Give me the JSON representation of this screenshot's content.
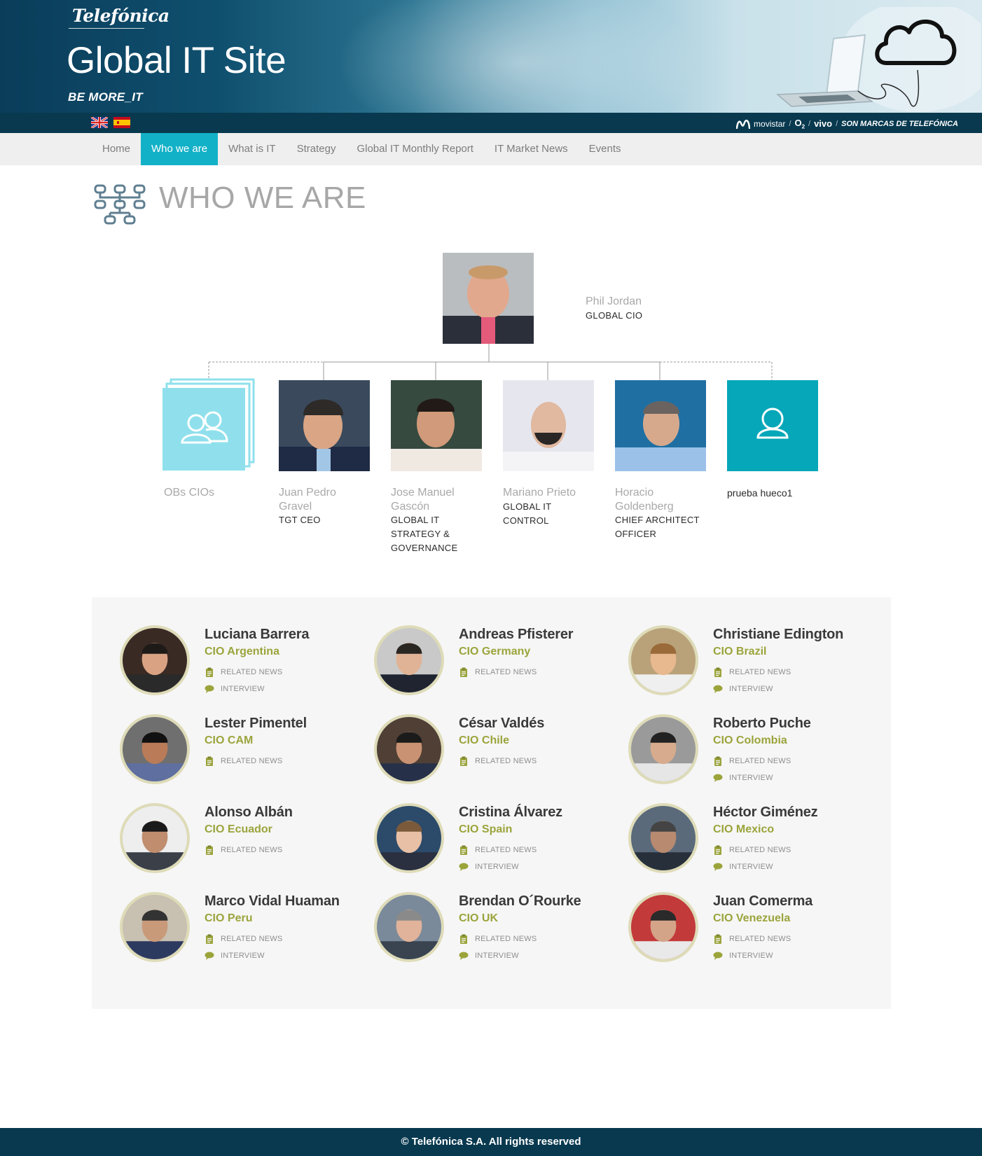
{
  "header": {
    "brand": "Telefónica",
    "site_title": "Global IT Site",
    "tagline": "BE MORE_IT",
    "brands": {
      "movistar": "movistar",
      "o2": "O",
      "o2_sub": "2",
      "vivo": "vivo",
      "owner": "SON MARCAS DE TELEFÓNICA"
    },
    "languages": [
      "English",
      "Español"
    ]
  },
  "nav": {
    "items": [
      {
        "label": "Home"
      },
      {
        "label": "Who we are"
      },
      {
        "label": "What is IT"
      },
      {
        "label": "Strategy"
      },
      {
        "label": "Global IT Monthly Report"
      },
      {
        "label": "IT Market News"
      },
      {
        "label": "Events"
      }
    ],
    "active": "Who we are"
  },
  "page": {
    "title": "WHO WE ARE"
  },
  "org": {
    "head": {
      "name": "Phil Jordan",
      "role": "GLOBAL CIO"
    },
    "reports": [
      {
        "name": "OBs CIOs",
        "role": ""
      },
      {
        "name_l1": "Juan Pedro",
        "name_l2": "Gravel",
        "role_l1": "TGT CEO"
      },
      {
        "name_l1": "Jose Manuel",
        "name_l2": "Gascón",
        "role_l1": "GLOBAL IT",
        "role_l2": "STRATEGY &",
        "role_l3": "GOVERNANCE"
      },
      {
        "name_l1": "Mariano Prieto",
        "role_l1": "GLOBAL IT",
        "role_l2": "CONTROL"
      },
      {
        "name_l1": "Horacio",
        "name_l2": "Goldenberg",
        "role_l1": "CHIEF ARCHITECT",
        "role_l2": "OFFICER"
      },
      {
        "name_l1": "prueba hueco1"
      }
    ]
  },
  "cio_links": {
    "news": "RELATED NEWS",
    "interview": "INTERVIEW"
  },
  "cios": [
    {
      "name": "Luciana Barrera",
      "title": "CIO Argentina",
      "interview": true
    },
    {
      "name": "Andreas Pfisterer",
      "title": "CIO Germany",
      "interview": false
    },
    {
      "name": "Christiane Edington",
      "title": "CIO Brazil",
      "interview": true
    },
    {
      "name": "Lester Pimentel",
      "title": "CIO CAM",
      "interview": false
    },
    {
      "name": "César Valdés",
      "title": "CIO Chile",
      "interview": false
    },
    {
      "name": "Roberto Puche",
      "title": "CIO Colombia",
      "interview": true
    },
    {
      "name": "Alonso Albán",
      "title": "CIO Ecuador",
      "interview": false
    },
    {
      "name": "Cristina Álvarez",
      "title": "CIO Spain",
      "interview": true
    },
    {
      "name": "Héctor Giménez",
      "title": "CIO Mexico",
      "interview": true
    },
    {
      "name": "Marco Vidal Huaman",
      "title": "CIO Peru",
      "interview": true
    },
    {
      "name": "Brendan O´Rourke",
      "title": "CIO UK",
      "interview": true
    },
    {
      "name": "Juan Comerma",
      "title": "CIO Venezuela",
      "interview": true
    }
  ],
  "footer": {
    "text": "© Telefónica S.A. All rights reserved"
  },
  "colors": {
    "accent": "#13b1c7",
    "navy": "#08394f",
    "olive": "#9ba43b",
    "ring": "#dedbb8"
  }
}
